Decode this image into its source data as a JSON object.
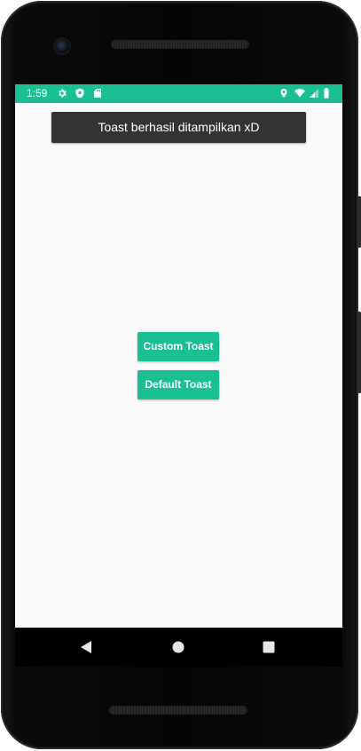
{
  "status_bar": {
    "time": "1:59",
    "background_color": "#1bbf94",
    "left_icons": [
      "gear-icon",
      "shield-icon",
      "sd-card-icon"
    ],
    "right_icons": [
      "location-icon",
      "wifi-icon",
      "cell-signal-icon",
      "battery-icon"
    ]
  },
  "toast": {
    "message": "Toast berhasil ditampilkan xD",
    "background_color": "#333333"
  },
  "buttons": {
    "custom_toast_label": "Custom Toast",
    "default_toast_label": "Default Toast",
    "color": "#1bbf94"
  },
  "nav_bar": {
    "icons": [
      "back-icon",
      "home-icon",
      "recents-icon"
    ]
  }
}
